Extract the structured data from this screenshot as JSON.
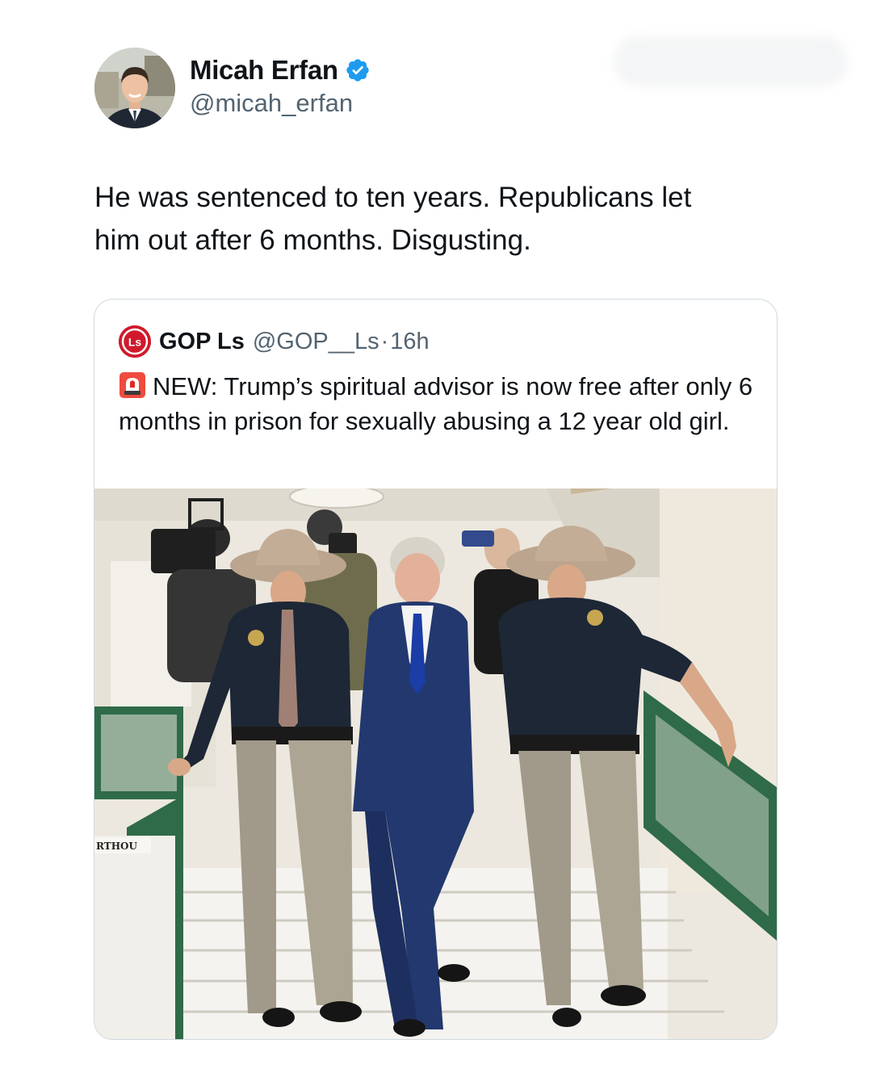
{
  "author": {
    "name": "Micah Erfan",
    "handle": "@micah_erfan",
    "verified": true,
    "verified_color": "#1d9bf0"
  },
  "tweet": {
    "lines": [
      "He was sentenced to ten years. Republicans let",
      "him out after 6 months. Disgusting."
    ]
  },
  "quoted": {
    "name": "GOP Ls",
    "handle": "@GOP__Ls",
    "separator": "·",
    "time": "16h",
    "avatar_text": "Ls",
    "avatar_color": "#d1192c",
    "emoji_icon": "rotating-light-icon",
    "text": "NEW: Trump’s spiritual advisor is now free after only 6 months in prison for sexually abusing a 12 year old girl.",
    "photo_sign_text": "RTHOU"
  },
  "colors": {
    "text": "#0f1419",
    "secondary": "#536471",
    "border": "#cfd9de"
  }
}
